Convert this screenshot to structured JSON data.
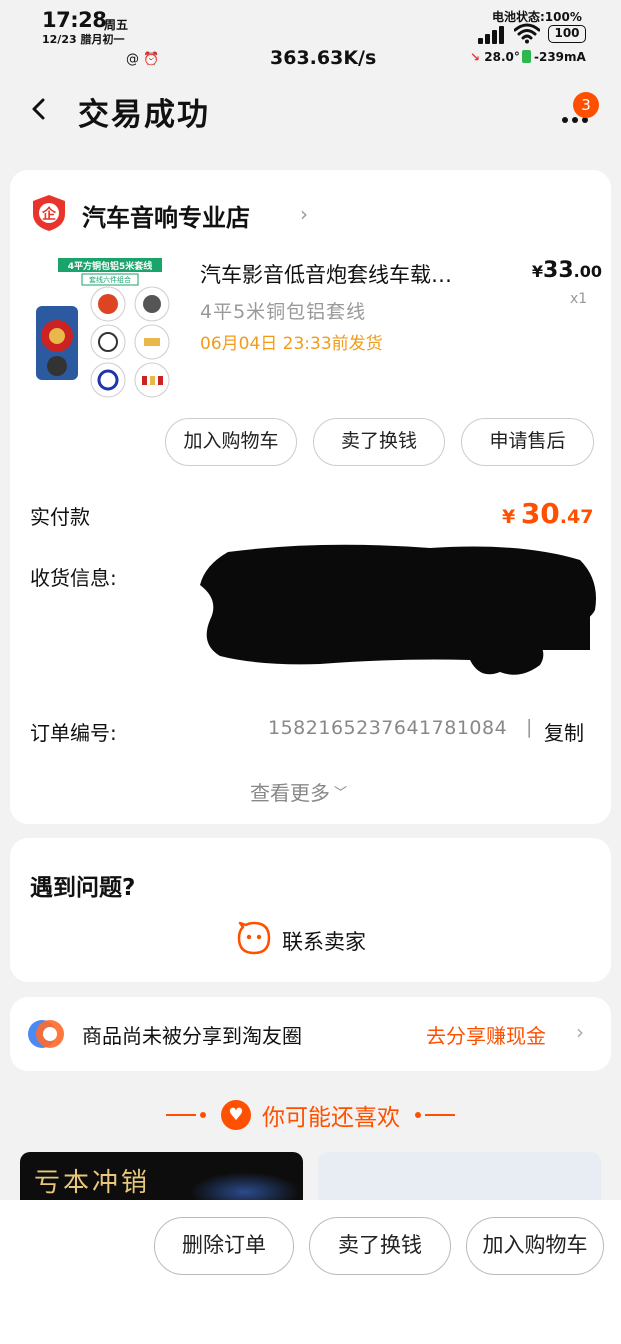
{
  "status_bar": {
    "time": "17:28",
    "weekday": "周五",
    "date": "12/23 腊月初一",
    "left_icons": "@ ⏰",
    "net_speed": "363.63K/s",
    "battery_status": "电池状态:100%",
    "battery_level": "100",
    "temperature": "28.0°",
    "current": "-239mA"
  },
  "nav": {
    "title": "交易成功",
    "more_badge": "3"
  },
  "order": {
    "shop_name": "汽车音响专业店",
    "product": {
      "title": "汽车影音低音炮套线车载…",
      "spec": "4平5米铜包铝套线",
      "ship_time": "06月04日 23:33前发货",
      "price_symbol": "¥",
      "price_int": "33",
      "price_dec": ".00",
      "qty": "x1",
      "image_labels": {
        "banner": "4平方铜包铝5米套线",
        "sub": "套线六件组合"
      }
    },
    "actions": {
      "add_cart": "加入购物车",
      "resell": "卖了换钱",
      "after_sale": "申请售后"
    },
    "paid_label": "实付款",
    "paid_symbol": "¥",
    "paid_int": "30",
    "paid_dec": ".47",
    "address_label": "收货信息:",
    "order_no_label": "订单编号:",
    "order_no": "1582165237641781084",
    "separator": "|",
    "copy": "复制",
    "view_more": "查看更多"
  },
  "problem": {
    "title": "遇到问题?",
    "contact": "联系卖家"
  },
  "share": {
    "text": "商品尚未被分享到淘友圈",
    "link": "去分享赚现金"
  },
  "recommend": {
    "title": "你可能还喜欢",
    "items": [
      {
        "text": "亏本冲销"
      },
      {
        "text": ""
      }
    ]
  },
  "bottom_bar": {
    "delete": "删除订单",
    "resell": "卖了换钱",
    "add_cart": "加入购物车"
  },
  "colors": {
    "accent": "#ff5000",
    "ship_time": "#f29b1a",
    "background": "#f2f2f2"
  }
}
